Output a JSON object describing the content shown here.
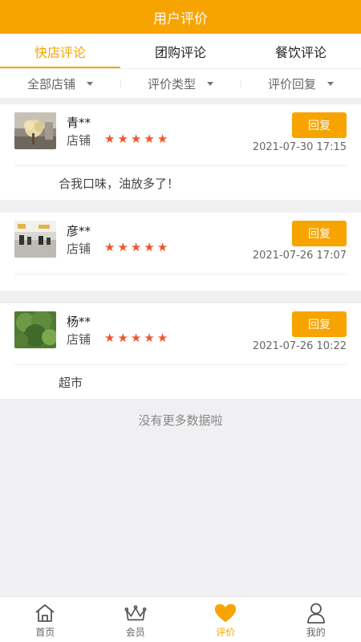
{
  "header": {
    "title": "用户评价"
  },
  "tabs": [
    {
      "label": "快店评论",
      "active": true
    },
    {
      "label": "团购评论",
      "active": false
    },
    {
      "label": "餐饮评论",
      "active": false
    }
  ],
  "filters": [
    {
      "label": "全部店铺"
    },
    {
      "label": "评价类型"
    },
    {
      "label": "评价回复"
    }
  ],
  "reviews": [
    {
      "user": "青**",
      "source": "店铺",
      "rating": 5,
      "time": "2021-07-30 17:15",
      "reply_label": "回复",
      "comment": "合我口味，油放多了！"
    },
    {
      "user": "彦**",
      "source": "店铺",
      "rating": 5,
      "time": "2021-07-26 17:07",
      "reply_label": "回复",
      "comment": ""
    },
    {
      "user": "杨**",
      "source": "店铺",
      "rating": 5,
      "time": "2021-07-26 10:22",
      "reply_label": "回复",
      "comment": "超市"
    }
  ],
  "footer_text": "没有更多数据啦",
  "bottom_nav": [
    {
      "label": "首页",
      "icon": "home-icon",
      "active": false
    },
    {
      "label": "会员",
      "icon": "crown-icon",
      "active": false
    },
    {
      "label": "评价",
      "icon": "heart-icon",
      "active": true
    },
    {
      "label": "我的",
      "icon": "user-icon",
      "active": false
    }
  ],
  "colors": {
    "accent": "#f7a400",
    "star": "#f1542a",
    "background": "#f0f0f3"
  }
}
